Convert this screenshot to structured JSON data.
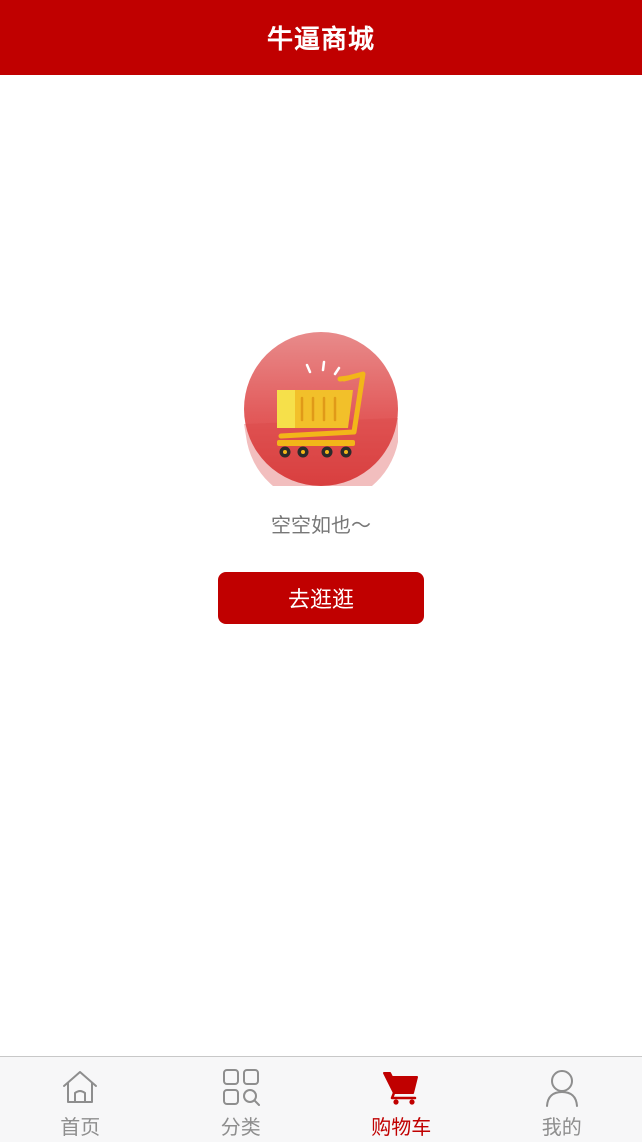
{
  "header": {
    "title": "牛逼商城"
  },
  "empty_state": {
    "illustration": "shopping-cart-icon",
    "message": "空空如也～",
    "button_label": "去逛逛"
  },
  "tabbar": {
    "items": [
      {
        "label": "首页",
        "icon": "home-icon",
        "active": false
      },
      {
        "label": "分类",
        "icon": "category-grid-icon",
        "active": false
      },
      {
        "label": "购物车",
        "icon": "cart-icon",
        "active": true
      },
      {
        "label": "我的",
        "icon": "user-icon",
        "active": false
      }
    ]
  },
  "colors": {
    "brand": "#c00000",
    "tab_inactive": "#8e8e8e",
    "cart_yellow": "#f2b619"
  }
}
